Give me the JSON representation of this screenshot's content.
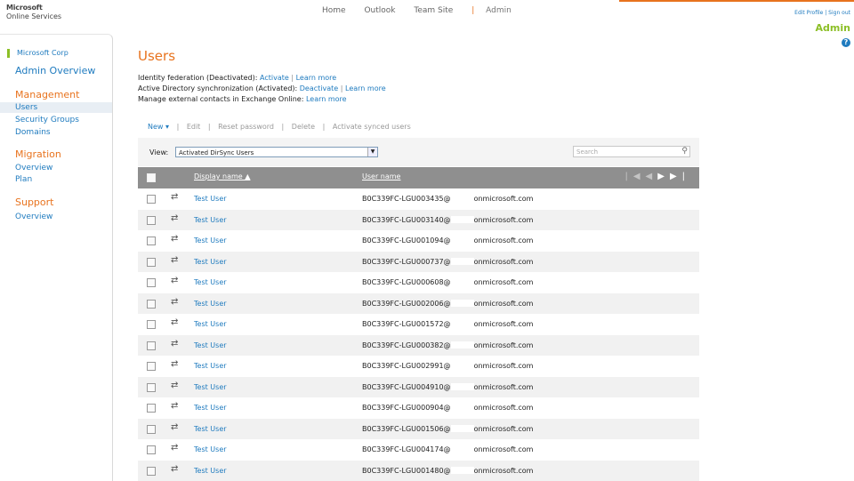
{
  "header": {
    "logo_line1": "Microsoft",
    "logo_line2": "Online Services",
    "nav": [
      "Home",
      "Outlook",
      "Team Site"
    ],
    "nav_separator": "|",
    "nav_admin": "Admin",
    "sign_links": "Edit Profile  |  Sign out",
    "admin_label": "Admin",
    "help": "?"
  },
  "sidebar": {
    "org": "Microsoft Corp",
    "admin_overview": "Admin Overview",
    "sections": [
      {
        "title": "Management",
        "items": [
          "Users",
          "Security Groups",
          "Domains"
        ]
      },
      {
        "title": "Migration",
        "items": [
          "Overview",
          "Plan"
        ]
      },
      {
        "title": "Support",
        "items": [
          "Overview"
        ]
      }
    ]
  },
  "main": {
    "title": "Users",
    "info": [
      {
        "text": "Identity federation (Deactivated):",
        "links": [
          "Activate",
          "Learn more"
        ]
      },
      {
        "text": "Active Directory synchronization (Activated):",
        "links": [
          "Deactivate",
          "Learn more"
        ]
      },
      {
        "text": "Manage external contacts in Exchange Online:",
        "links": [
          "Learn more"
        ]
      }
    ],
    "toolbar": [
      "New ▾",
      "Edit",
      "Reset password",
      "Delete",
      "Activate synced users"
    ],
    "view_label": "View:",
    "view_value": "Activated DirSync Users",
    "search_placeholder": "Search",
    "columns": {
      "display_name": "Display name ▲",
      "user_name": "User name"
    },
    "pager": {
      "first": "|◀",
      "prev": "◀",
      "next": "▶",
      "last": "▶|"
    },
    "domain_suffix": "onmicrosoft.com",
    "rows": [
      {
        "display": "Test User",
        "user": "B0C339FC-LGU003435@"
      },
      {
        "display": "Test User",
        "user": "B0C339FC-LGU003140@"
      },
      {
        "display": "Test User",
        "user": "B0C339FC-LGU001094@"
      },
      {
        "display": "Test User",
        "user": "B0C339FC-LGU000737@"
      },
      {
        "display": "Test User",
        "user": "B0C339FC-LGU000608@"
      },
      {
        "display": "Test User",
        "user": "B0C339FC-LGU002006@"
      },
      {
        "display": "Test User",
        "user": "B0C339FC-LGU001572@"
      },
      {
        "display": "Test User",
        "user": "B0C339FC-LGU000382@"
      },
      {
        "display": "Test User",
        "user": "B0C339FC-LGU002991@"
      },
      {
        "display": "Test User",
        "user": "B0C339FC-LGU004910@"
      },
      {
        "display": "Test User",
        "user": "B0C339FC-LGU000904@"
      },
      {
        "display": "Test User",
        "user": "B0C339FC-LGU001506@"
      },
      {
        "display": "Test User",
        "user": "B0C339FC-LGU004174@"
      },
      {
        "display": "Test User",
        "user": "B0C339FC-LGU001480@"
      }
    ]
  }
}
